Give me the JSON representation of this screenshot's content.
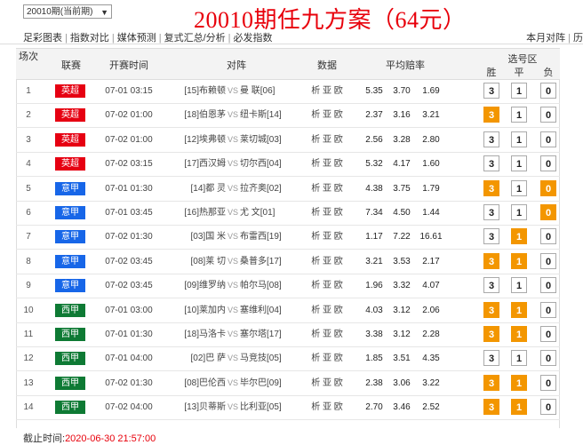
{
  "topbar": {
    "period_select": "20010期(当前期)",
    "title": "20010期任九方案（64元）"
  },
  "nav": {
    "left": [
      "足彩图表",
      "指数对比",
      "媒体预测",
      "复式汇总/分析",
      "必发指数"
    ],
    "right": [
      "本月对阵",
      "历"
    ]
  },
  "table": {
    "headers": {
      "no": "场次",
      "league": "联赛",
      "time": "开赛时间",
      "match": "对阵",
      "data": "数据",
      "odds": "平均赔率",
      "pick_area": "选号区",
      "win": "胜",
      "draw": "平",
      "lose": "负"
    },
    "rows": [
      {
        "no": "1",
        "league": "英超",
        "league_color": "#e60012",
        "time": "07-01 03:15",
        "home": "[15]布赖顿",
        "vs": "VS",
        "away": "曼 联[06]",
        "data": "析 亚 欧",
        "o1": "5.35",
        "o2": "3.70",
        "o3": "1.69",
        "p3": false,
        "p1": false,
        "p0": false
      },
      {
        "no": "2",
        "league": "英超",
        "league_color": "#e60012",
        "time": "07-02 01:00",
        "home": "[18]伯恩茅",
        "vs": "VS",
        "away": "纽卡斯[14]",
        "data": "析 亚 欧",
        "o1": "2.37",
        "o2": "3.16",
        "o3": "3.21",
        "p3": true,
        "p1": false,
        "p0": false
      },
      {
        "no": "3",
        "league": "英超",
        "league_color": "#e60012",
        "time": "07-02 01:00",
        "home": "[12]埃弗顿",
        "vs": "VS",
        "away": "莱切城[03]",
        "data": "析 亚 欧",
        "o1": "2.56",
        "o2": "3.28",
        "o3": "2.80",
        "p3": false,
        "p1": false,
        "p0": false
      },
      {
        "no": "4",
        "league": "英超",
        "league_color": "#e60012",
        "time": "07-02 03:15",
        "home": "[17]西汉姆",
        "vs": "VS",
        "away": "切尔西[04]",
        "data": "析 亚 欧",
        "o1": "5.32",
        "o2": "4.17",
        "o3": "1.60",
        "p3": false,
        "p1": false,
        "p0": false
      },
      {
        "no": "5",
        "league": "意甲",
        "league_color": "#1766e8",
        "time": "07-01 01:30",
        "home": "[14]都 灵",
        "vs": "VS",
        "away": "拉齐奥[02]",
        "data": "析 亚 欧",
        "o1": "4.38",
        "o2": "3.75",
        "o3": "1.79",
        "p3": true,
        "p1": false,
        "p0": true
      },
      {
        "no": "6",
        "league": "意甲",
        "league_color": "#1766e8",
        "time": "07-01 03:45",
        "home": "[16]热那亚",
        "vs": "VS",
        "away": "尤 文[01]",
        "data": "析 亚 欧",
        "o1": "7.34",
        "o2": "4.50",
        "o3": "1.44",
        "p3": false,
        "p1": false,
        "p0": true
      },
      {
        "no": "7",
        "league": "意甲",
        "league_color": "#1766e8",
        "time": "07-02 01:30",
        "home": "[03]国 米",
        "vs": "VS",
        "away": "布雷西[19]",
        "data": "析 亚 欧",
        "o1": "1.17",
        "o2": "7.22",
        "o3": "16.61",
        "p3": false,
        "p1": true,
        "p0": false
      },
      {
        "no": "8",
        "league": "意甲",
        "league_color": "#1766e8",
        "time": "07-02 03:45",
        "home": "[08]莱 切",
        "vs": "VS",
        "away": "桑普多[17]",
        "data": "析 亚 欧",
        "o1": "3.21",
        "o2": "3.53",
        "o3": "2.17",
        "p3": true,
        "p1": true,
        "p0": false
      },
      {
        "no": "9",
        "league": "意甲",
        "league_color": "#1766e8",
        "time": "07-02 03:45",
        "home": "[09]维罗纳",
        "vs": "VS",
        "away": "帕尔马[08]",
        "data": "析 亚 欧",
        "o1": "1.96",
        "o2": "3.32",
        "o3": "4.07",
        "p3": false,
        "p1": false,
        "p0": false
      },
      {
        "no": "10",
        "league": "西甲",
        "league_color": "#0e7a34",
        "time": "07-01 03:00",
        "home": "[10]莱加内",
        "vs": "VS",
        "away": "塞维利[04]",
        "data": "析 亚 欧",
        "o1": "4.03",
        "o2": "3.12",
        "o3": "2.06",
        "p3": true,
        "p1": true,
        "p0": false
      },
      {
        "no": "11",
        "league": "西甲",
        "league_color": "#0e7a34",
        "time": "07-01 01:30",
        "home": "[18]马洛卡",
        "vs": "VS",
        "away": "塞尔塔[17]",
        "data": "析 亚 欧",
        "o1": "3.38",
        "o2": "3.12",
        "o3": "2.28",
        "p3": true,
        "p1": true,
        "p0": false
      },
      {
        "no": "12",
        "league": "西甲",
        "league_color": "#0e7a34",
        "time": "07-01 04:00",
        "home": "[02]巴 萨",
        "vs": "VS",
        "away": "马竞技[05]",
        "data": "析 亚 欧",
        "o1": "1.85",
        "o2": "3.51",
        "o3": "4.35",
        "p3": false,
        "p1": false,
        "p0": false
      },
      {
        "no": "13",
        "league": "西甲",
        "league_color": "#0e7a34",
        "time": "07-02 01:30",
        "home": "[08]巴伦西",
        "vs": "VS",
        "away": "毕尔巴[09]",
        "data": "析 亚 欧",
        "o1": "2.38",
        "o2": "3.06",
        "o3": "3.22",
        "p3": true,
        "p1": true,
        "p0": false
      },
      {
        "no": "14",
        "league": "西甲",
        "league_color": "#0e7a34",
        "time": "07-02 04:00",
        "home": "[13]贝蒂斯",
        "vs": "VS",
        "away": "比利亚[05]",
        "data": "析 亚 欧",
        "o1": "2.70",
        "o2": "3.46",
        "o3": "2.52",
        "p3": true,
        "p1": true,
        "p0": false
      }
    ]
  },
  "footer": {
    "label": "截止时间:",
    "timestamp": "2020-06-30 21:57:00"
  },
  "colors": {
    "accent_orange": "#f39600",
    "title_red": "#e8000b"
  }
}
